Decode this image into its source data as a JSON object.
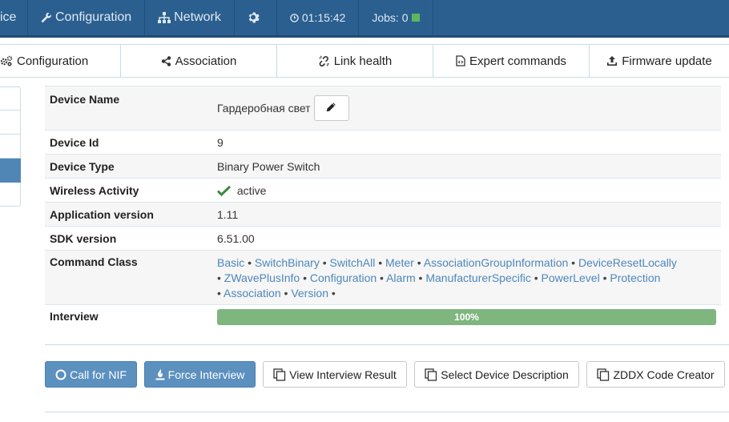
{
  "navbar": {
    "items": [
      {
        "label": "ice"
      },
      {
        "label": "Configuration",
        "icon": "wrench-icon"
      },
      {
        "label": "Network",
        "icon": "sitemap-icon"
      },
      {
        "label": "",
        "icon": "gear-icon"
      },
      {
        "label": "01:15:42",
        "icon": "clock-icon"
      },
      {
        "label": "Jobs: 0",
        "status_color": "#5cb85c"
      }
    ]
  },
  "tabs": [
    {
      "label": "Configuration",
      "icon": "gears-icon"
    },
    {
      "label": "Association",
      "icon": "share-icon"
    },
    {
      "label": "Link health",
      "icon": "broken-link-icon"
    },
    {
      "label": "Expert commands",
      "icon": "code-file-icon"
    },
    {
      "label": "Firmware update",
      "icon": "upload-icon"
    }
  ],
  "device": {
    "rows": {
      "name": {
        "label": "Device Name",
        "value": "Гардеробная свет"
      },
      "id": {
        "label": "Device Id",
        "value": "9"
      },
      "type": {
        "label": "Device Type",
        "value": "Binary Power Switch"
      },
      "wireless": {
        "label": "Wireless Activity",
        "value": "active"
      },
      "app_version": {
        "label": "Application version",
        "value": "1.11"
      },
      "sdk_version": {
        "label": "SDK version",
        "value": "6.51.00"
      },
      "command_class": {
        "label": "Command Class",
        "items": [
          "Basic",
          "SwitchBinary",
          "SwitchAll",
          "Meter",
          "AssociationGroupInformation",
          "DeviceResetLocally",
          "ZWavePlusInfo",
          "Configuration",
          "Alarm",
          "ManufacturerSpecific",
          "PowerLevel",
          "Protection",
          "Association",
          "Version"
        ]
      },
      "interview": {
        "label": "Interview",
        "progress_text": "100%",
        "progress": 100
      }
    }
  },
  "buttons": {
    "call_nif": "Call for NIF",
    "force_interview": "Force Interview",
    "view_interview_result": "View Interview Result",
    "select_device_description": "Select Device Description",
    "zddx_code_creator": "ZDDX Code Creator"
  },
  "colors": {
    "navbar": "#2b5f8f",
    "primary_button": "#5b90bf",
    "link": "#4d87bb",
    "progress": "#7fb57f",
    "active_check": "#3a8a3a"
  }
}
